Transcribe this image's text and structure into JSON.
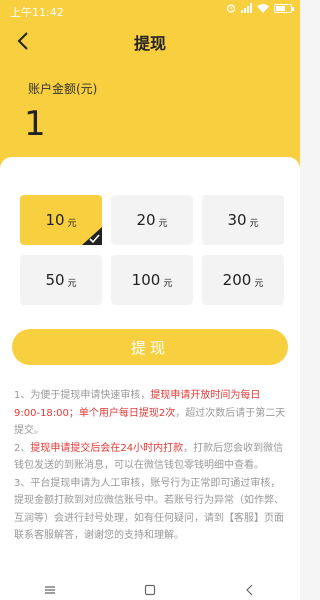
{
  "status_bar": {
    "time": "上午11:42"
  },
  "header": {
    "title": "提现",
    "balance_label": "账户金额(元)",
    "balance_value": "1"
  },
  "amounts": [
    {
      "value": "10",
      "unit": "元",
      "selected": true
    },
    {
      "value": "20",
      "unit": "元",
      "selected": false
    },
    {
      "value": "30",
      "unit": "元",
      "selected": false
    },
    {
      "value": "50",
      "unit": "元",
      "selected": false
    },
    {
      "value": "100",
      "unit": "元",
      "selected": false
    },
    {
      "value": "200",
      "unit": "元",
      "selected": false
    }
  ],
  "withdraw_button": {
    "label": "提现"
  },
  "notes": {
    "n1_a": "1、为便于提现申请快速审核，",
    "n1_red": "提现申请开放时间为每日9:00-18:00；单个用户每日提现2次",
    "n1_b": "，超过次数后请于第二天提交。",
    "n2_a": "2、",
    "n2_red": "提现申请提交后会在24小时内打款",
    "n2_b": "，打款后您会收到微信钱包发送的到账消息，可以在微信钱包零钱明细中查看。",
    "n3": "3、平台提现申请为人工审核，账号行为正常即可通过审核，提现金额打款到对应微信账号中。若账号行为异常（如作弊、互润等）会进行封号处理，如有任何疑问，请到【客服】页面联系客服解答，谢谢您的支持和理解。"
  },
  "colors": {
    "accent": "#f8cf3f",
    "warning_text": "#e53935"
  },
  "icons": [
    "back-arrow-icon",
    "checkmark-icon",
    "menu-icon",
    "home-icon",
    "back-icon"
  ]
}
